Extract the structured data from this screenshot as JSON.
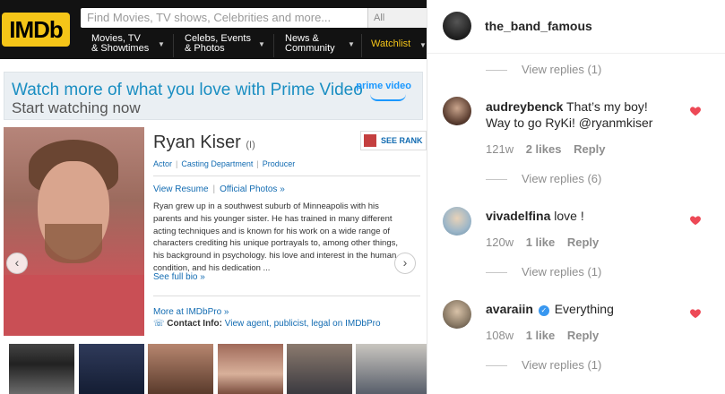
{
  "imdb": {
    "logo_text": "IMDb",
    "search_placeholder": "Find Movies, TV shows, Celebrities and more...",
    "search_category": "All",
    "nav": [
      {
        "line1": "Movies, TV",
        "line2": "& Showtimes"
      },
      {
        "line1": "Celebs, Events",
        "line2": "& Photos"
      },
      {
        "line1": "News &",
        "line2": "Community"
      },
      {
        "line1": "Watchlist",
        "line2": ""
      }
    ],
    "brand_yellow": "#f5c518"
  },
  "prime_banner": {
    "line1": "Watch more of what you love with Prime Video",
    "line2": "Start watching now",
    "logo": "prime video"
  },
  "profile": {
    "name": "Ryan Kiser",
    "name_suffix": "(I)",
    "see_rank": "SEE RANK",
    "roles": [
      "Actor",
      "Casting Department",
      "Producer"
    ],
    "view_resume": "View Resume",
    "official_photos": "Official Photos »",
    "bio": "Ryan grew up in a southwest suburb of Minneapolis with his parents and his younger sister. He has trained in many different acting techniques and is known for his work on a wide range of characters crediting his unique portrayals to, among other things, his background in psychology. his love and interest in the human condition, and his dedication ...",
    "see_full_bio": "See full bio »",
    "more_at": "More at IMDbPro »",
    "contact_label": "Contact Info:",
    "contact_link": "View agent, publicist, legal on IMDbPro",
    "link_color": "#136cb2"
  },
  "instagram": {
    "post_author": "the_band_famous",
    "comments": [
      {
        "user": "audreybenck",
        "text": "That's my boy! Way to go RyKi! @ryanmkiser",
        "line1": "That’s my boy!",
        "line2": "Way to go RyKi! @ryanmkiser",
        "age": "121w",
        "likes": "2 likes",
        "reply": "Reply",
        "view_replies": "View replies (6)"
      },
      {
        "user": "vivadelfina",
        "text": "love !",
        "age": "120w",
        "likes": "1 like",
        "reply": "Reply",
        "view_replies": "View replies (1)"
      },
      {
        "user": "avaraiin",
        "text": "Everything",
        "verified": true,
        "age": "108w",
        "likes": "1 like",
        "reply": "Reply",
        "view_replies": "View replies (1)"
      }
    ],
    "top_view_replies": "View replies (1)",
    "heart_color": "#ed4956"
  }
}
